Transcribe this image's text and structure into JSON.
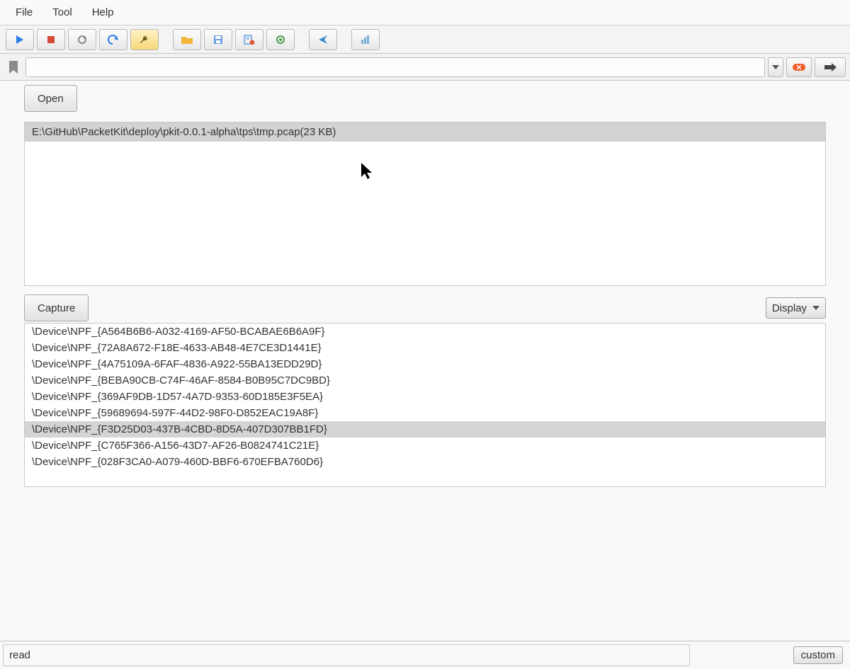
{
  "menu": {
    "file": "File",
    "tool": "Tool",
    "help": "Help"
  },
  "open_section": {
    "button": "Open",
    "recent_file": "E:\\GitHub\\PacketKit\\deploy\\pkit-0.0.1-alpha\\tps\\tmp.pcap(23 KB)"
  },
  "capture_section": {
    "button": "Capture",
    "display": "Display",
    "selected_index": 6,
    "devices": [
      "\\Device\\NPF_{A564B6B6-A032-4169-AF50-BCABAE6B6A9F}",
      "\\Device\\NPF_{72A8A672-F18E-4633-AB48-4E7CE3D1441E}",
      "\\Device\\NPF_{4A75109A-6FAF-4836-A922-55BA13EDD29D}",
      "\\Device\\NPF_{BEBA90CB-C74F-46AF-8584-B0B95C7DC9BD}",
      "\\Device\\NPF_{369AF9DB-1D57-4A7D-9353-60D185E3F5EA}",
      "\\Device\\NPF_{59689694-597F-44D2-98F0-D852EAC19A8F}",
      "\\Device\\NPF_{F3D25D03-437B-4CBD-8D5A-407D307BB1FD}",
      "\\Device\\NPF_{C765F366-A156-43D7-AF26-B0824741C21E}",
      "\\Device\\NPF_{028F3CA0-A079-460D-BBF6-670EFBA760D6}"
    ]
  },
  "status": {
    "left": "read",
    "right_button": "custom"
  },
  "filter": {
    "value": ""
  }
}
